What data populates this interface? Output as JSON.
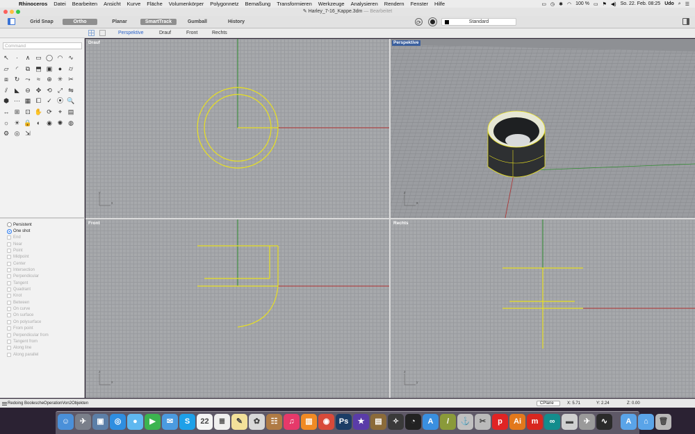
{
  "menubar": {
    "apple": "",
    "app_name": "Rhinoceros",
    "items": [
      "Datei",
      "Bearbeiten",
      "Ansicht",
      "Kurve",
      "Fläche",
      "Volumenkörper",
      "Polygonnetz",
      "Bemaßung",
      "Transformieren",
      "Werkzeuge",
      "Analysieren",
      "Rendern",
      "Fenster",
      "Hilfe"
    ],
    "status": {
      "battery": "100 %",
      "datetime": "So. 22. Feb.  08:25",
      "user": "Udo"
    }
  },
  "window": {
    "title": "Harley_7-16_Kappe.3dm",
    "edited": "— Bearbeitet",
    "traffic_colors": [
      "#fc605c",
      "#fdbc40",
      "#34c84a"
    ]
  },
  "toolbar": {
    "grid_snap": "Grid Snap",
    "ortho": "Ortho",
    "planar": "Planar",
    "smarttrack": "SmartTrack",
    "gumball": "Gumball",
    "history": "History",
    "layer": "Standard"
  },
  "viewport_tabs": [
    "Perspektive",
    "Drauf",
    "Front",
    "Rechts"
  ],
  "command": {
    "placeholder": "Command"
  },
  "toolbox_icons": [
    "select-arrow-icon",
    "point-icon",
    "polyline-icon",
    "rectangle-icon",
    "circle-icon",
    "arc-icon",
    "curve-icon",
    "rect-surface-icon",
    "fillet-icon",
    "offset-icon",
    "extrude-icon",
    "box-icon",
    "sphere-icon",
    "cylinder-icon",
    "loft-icon",
    "revolve-icon",
    "sweep-icon",
    "blend-icon",
    "join-icon",
    "explode-icon",
    "trim-icon",
    "split-icon",
    "chamfer-icon",
    "boolean-icon",
    "move-icon",
    "rotate-icon",
    "scale-icon",
    "mirror-icon",
    "solid-icon",
    "array-icon",
    "grid-icon",
    "group-icon",
    "check-icon",
    "analyze-icon",
    "zoom-icon",
    "dimension-icon",
    "zoom-window-icon",
    "zoom-extents-icon",
    "pan-icon",
    "orbit-icon",
    "camera-icon",
    "layer-icon",
    "light-icon",
    "bulb-icon",
    "lock-icon",
    "material-icon",
    "render-icon",
    "color-wheel-icon",
    "globe-icon",
    "gear-icon",
    "earth-icon",
    "transform-icon"
  ],
  "osnap": {
    "modes": [
      "Persistent",
      "One shot"
    ],
    "selected": "One shot",
    "snaps": [
      "End",
      "Near",
      "Point",
      "Midpoint",
      "Center",
      "Intersection",
      "Perpendicular",
      "Tangent",
      "Quadrant",
      "Knot",
      "Between",
      "On curve",
      "On surface",
      "On polysurface",
      "From point",
      "Perpendicular from",
      "Tangent from",
      "Along line",
      "Along parallel"
    ]
  },
  "viewports": {
    "top": "Drauf",
    "perspective": "Perspektive",
    "front": "Front",
    "right": "Rechts",
    "axis_x": "x",
    "axis_y": "y",
    "axis_z": "z"
  },
  "colors": {
    "curve_yellow": "#e8e020",
    "x_axis": "#b03030",
    "y_axis": "#2e8b2e",
    "active_tab": "#2a62c9",
    "active_label": "#3a5f9e"
  },
  "statusbar": {
    "message": "Redoing BoolescheOperationVon2Objekten",
    "cplane": "CPlane",
    "x": "X: 5.71",
    "y": "Y: 2.24",
    "z": "Z: 0.00"
  },
  "dock": [
    {
      "name": "finder-icon",
      "color": "#4a90d9",
      "glyph": "☺"
    },
    {
      "name": "launchpad-icon",
      "color": "#7a7f8a",
      "glyph": "✈"
    },
    {
      "name": "preview-icon",
      "color": "#5c7fa8",
      "glyph": "▣"
    },
    {
      "name": "safari-icon",
      "color": "#2f8ee0",
      "glyph": "◎"
    },
    {
      "name": "messages-icon",
      "color": "#5fb8f0",
      "glyph": "●"
    },
    {
      "name": "facetime-icon",
      "color": "#3cb450",
      "glyph": "▶"
    },
    {
      "name": "mail-icon",
      "color": "#4b9be0",
      "glyph": "✉"
    },
    {
      "name": "skype-icon",
      "color": "#1ea0e8",
      "glyph": "S"
    },
    {
      "name": "calendar-icon",
      "color": "#f4f4f4",
      "glyph": "22"
    },
    {
      "name": "reminders-icon",
      "color": "#efefef",
      "glyph": "≣"
    },
    {
      "name": "notes-icon",
      "color": "#f3e19a",
      "glyph": "✎"
    },
    {
      "name": "photos-icon",
      "color": "#d8d8d8",
      "glyph": "✿"
    },
    {
      "name": "contacts-icon",
      "color": "#b07b45",
      "glyph": "☷"
    },
    {
      "name": "itunes-icon",
      "color": "#e6396a",
      "glyph": "♫"
    },
    {
      "name": "ibooks-icon",
      "color": "#f08a24",
      "glyph": "▥"
    },
    {
      "name": "appstore-icon",
      "color": "#d84a3a",
      "glyph": "◉"
    },
    {
      "name": "photoshop-icon",
      "color": "#1c3d66",
      "glyph": "Ps"
    },
    {
      "name": "imovie-icon",
      "color": "#5a3ca8",
      "glyph": "★"
    },
    {
      "name": "iphoto-icon",
      "color": "#8b6b3a",
      "glyph": "▤"
    },
    {
      "name": "motion-icon",
      "color": "#3a3a3a",
      "glyph": "✧"
    },
    {
      "name": "dashboard-icon",
      "color": "#222",
      "glyph": "◔"
    },
    {
      "name": "appstore2-icon",
      "color": "#3a8fe0",
      "glyph": "A"
    },
    {
      "name": "sketch-icon",
      "color": "#8a9a3a",
      "glyph": "/"
    },
    {
      "name": "graph-icon",
      "color": "#c0c0c0",
      "glyph": "⚓"
    },
    {
      "name": "draw-icon",
      "color": "#bababa",
      "glyph": "✂"
    },
    {
      "name": "pdf-icon",
      "color": "#e02424",
      "glyph": "p"
    },
    {
      "name": "illustrator-icon",
      "color": "#e2781c",
      "glyph": "Ai"
    },
    {
      "name": "rhino-m-icon",
      "color": "#d8271f",
      "glyph": "m"
    },
    {
      "name": "arduino-icon",
      "color": "#138d8d",
      "glyph": "∞"
    },
    {
      "name": "photobooth-icon",
      "color": "#cfcfcf",
      "glyph": "▬"
    },
    {
      "name": "rhino-icon",
      "color": "#9a9a9a",
      "glyph": "✈"
    },
    {
      "name": "activity-icon",
      "color": "#2a2a2a",
      "glyph": "∿"
    },
    {
      "name": "applications-folder-icon",
      "color": "#5aa4e8",
      "glyph": "A"
    },
    {
      "name": "documents-folder-icon",
      "color": "#5aa4e8",
      "glyph": "⌂"
    },
    {
      "name": "trash-icon",
      "color": "#b8b8b8",
      "glyph": "🗑"
    }
  ]
}
